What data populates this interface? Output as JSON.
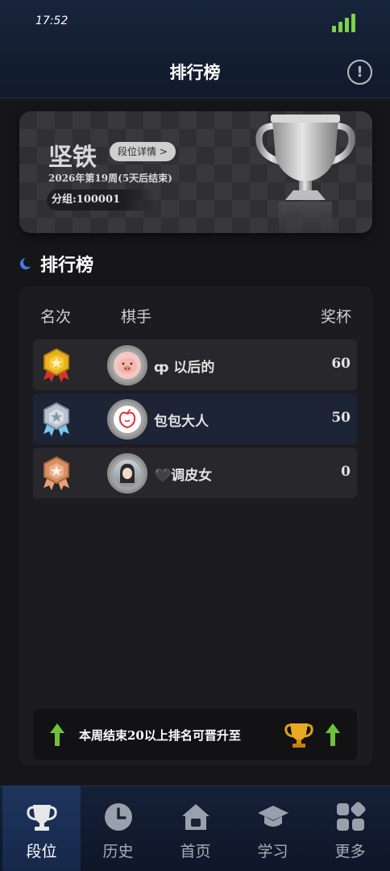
{
  "status_bar": {
    "time": "17:52"
  },
  "header": {
    "title": "排行榜",
    "info_icon": "info-icon"
  },
  "league": {
    "tier_name": "坚铁",
    "detail_button": "段位详情 >",
    "season": "2026年第19周(5天后结束)",
    "group": "分组:100001"
  },
  "ranking": {
    "section_title": "排行榜",
    "columns": {
      "rank": "名次",
      "player": "棋手",
      "cups": "奖杯"
    },
    "rows": [
      {
        "medal": "gold",
        "name": "ȹ 以后的",
        "cups": "60",
        "avatar": "pig-avatar",
        "highlighted": false
      },
      {
        "medal": "silver",
        "name": "包包大人",
        "cups": "50",
        "avatar": "apple-avatar",
        "highlighted": true
      },
      {
        "medal": "bronze",
        "name": "🖤调皮女",
        "cups": "0",
        "avatar": "girl-avatar",
        "highlighted": false
      }
    ]
  },
  "promotion": {
    "text": "本周结束20以上排名可晋升至"
  },
  "nav": {
    "items": [
      {
        "label": "段位",
        "icon": "trophy-icon",
        "active": true
      },
      {
        "label": "历史",
        "icon": "clock-icon",
        "active": false
      },
      {
        "label": "首页",
        "icon": "home-icon",
        "active": false
      },
      {
        "label": "学习",
        "icon": "graduation-cap-icon",
        "active": false
      },
      {
        "label": "更多",
        "icon": "grid-icon",
        "active": false
      }
    ]
  },
  "colors": {
    "accent_green": "#7fd04a",
    "gold": "#e0a21a",
    "silver": "#b9c3cf",
    "bronze": "#d68f62"
  }
}
